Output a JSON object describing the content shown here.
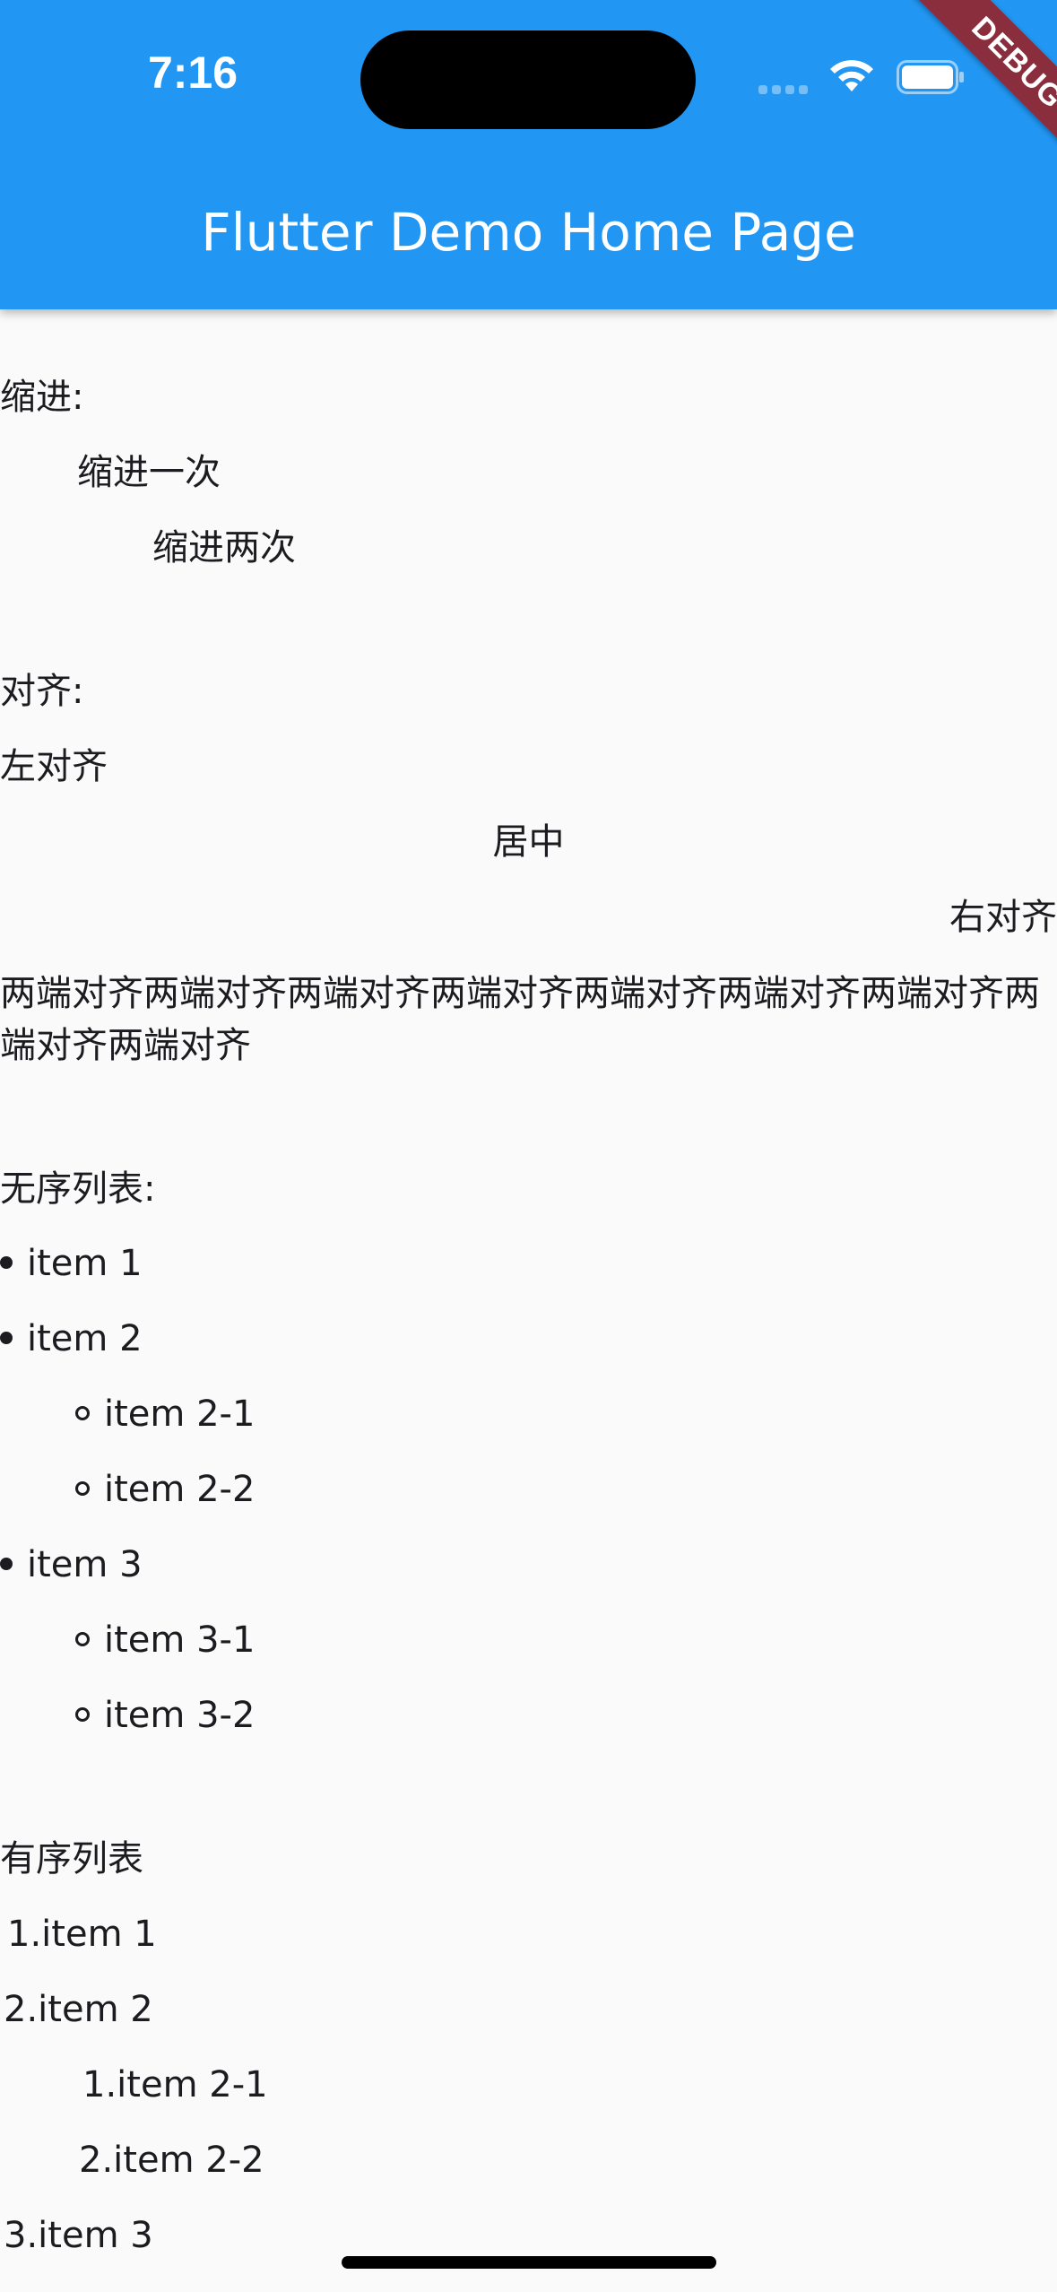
{
  "status_bar": {
    "time": "7:16",
    "debug_banner": "DEBUG"
  },
  "app_bar": {
    "title": "Flutter Demo Home Page"
  },
  "indent_section": {
    "heading": "缩进:",
    "indent_once": "缩进一次",
    "indent_twice": "缩进两次"
  },
  "align_section": {
    "heading": "对齐:",
    "left": "左对齐",
    "center": "居中",
    "right": "右对齐",
    "justify": "两端对齐两端对齐两端对齐两端对齐两端对齐两端对齐两端对齐两端对齐两端对齐"
  },
  "unordered_list": {
    "heading": "无序列表:",
    "items": [
      "item 1",
      "item 2",
      "item 2-1",
      "item 2-2",
      "item 3",
      "item 3-1",
      "item 3-2"
    ]
  },
  "ordered_list": {
    "heading": "有序列表",
    "items": [
      "1.item 1",
      "2.item 2",
      "1.item 2-1",
      "2.item 2-2",
      "3.item 3"
    ]
  }
}
